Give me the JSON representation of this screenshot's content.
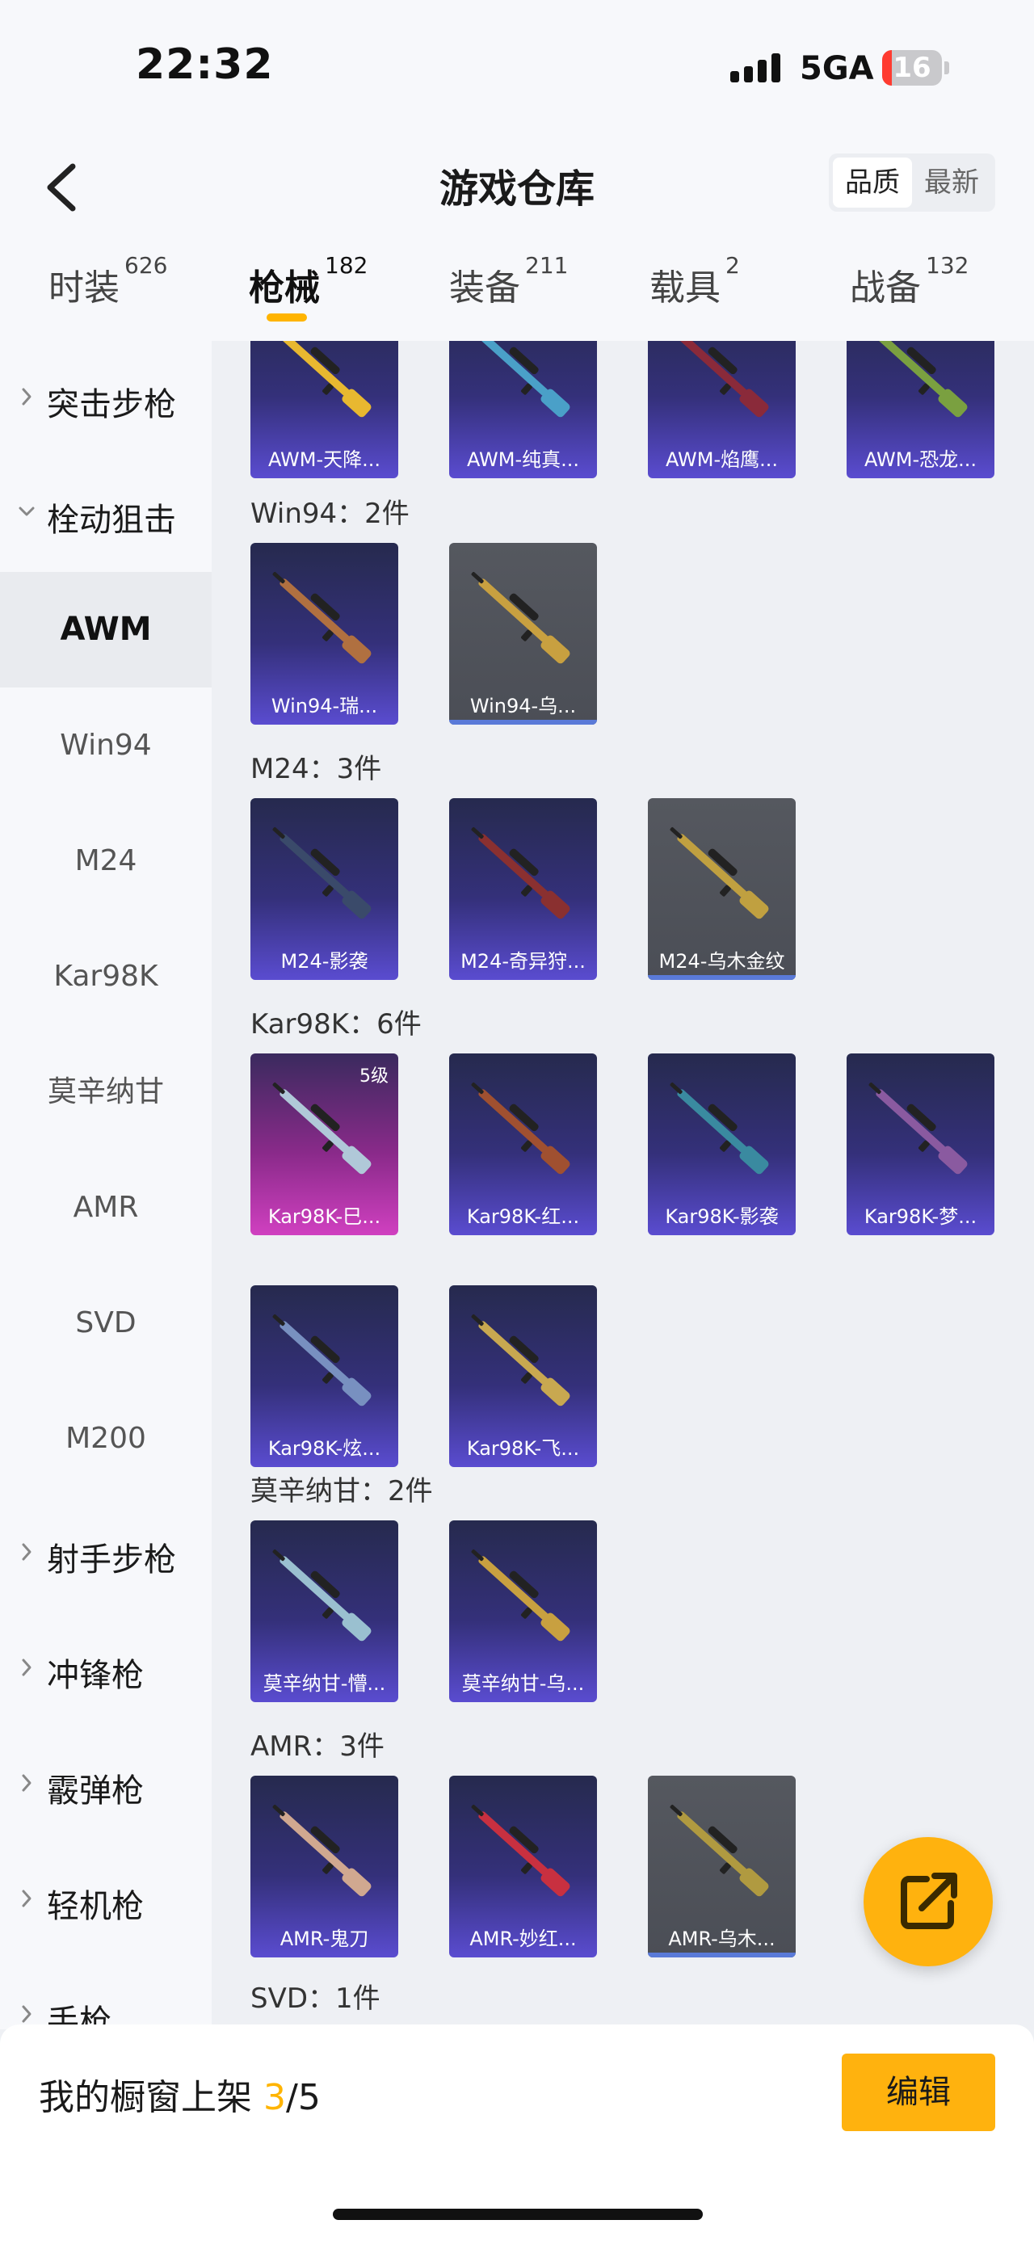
{
  "status_bar": {
    "time": "22:32",
    "network": "5GA",
    "battery": "16",
    "battery_level": 0.16
  },
  "header": {
    "title": "游戏仓库",
    "sort_options": [
      "品质",
      "最新"
    ],
    "sort_selected": "品质",
    "tabs": [
      {
        "label": "时装",
        "count": "626",
        "active": false
      },
      {
        "label": "枪械",
        "count": "182",
        "active": true
      },
      {
        "label": "装备",
        "count": "211",
        "active": false
      },
      {
        "label": "载具",
        "count": "2",
        "active": false
      },
      {
        "label": "战备",
        "count": "132",
        "active": false
      }
    ]
  },
  "sidebar": {
    "categories_top": [
      {
        "label": "突击步枪",
        "expanded": false
      },
      {
        "label": "栓动狙击",
        "expanded": true
      }
    ],
    "subs": [
      {
        "label": "AWM",
        "active": true
      },
      {
        "label": "Win94",
        "active": false
      },
      {
        "label": "M24",
        "active": false
      },
      {
        "label": "Kar98K",
        "active": false
      },
      {
        "label": "莫辛纳甘",
        "active": false
      },
      {
        "label": "AMR",
        "active": false
      },
      {
        "label": "SVD",
        "active": false
      },
      {
        "label": "M200",
        "active": false
      }
    ],
    "categories_bottom": [
      {
        "label": "射手步枪",
        "expanded": false
      },
      {
        "label": "冲锋枪",
        "expanded": false
      },
      {
        "label": "霰弹枪",
        "expanded": false
      },
      {
        "label": "轻机枪",
        "expanded": false
      },
      {
        "label": "手枪",
        "expanded": false
      }
    ]
  },
  "main": {
    "top_items": [
      {
        "name": "AWM-天降...",
        "rarity": "purple",
        "color": "#e8b830"
      },
      {
        "name": "AWM-纯真...",
        "rarity": "purple",
        "color": "#4aa0c8"
      },
      {
        "name": "AWM-焰鹰...",
        "rarity": "purple",
        "color": "#8a2a3a"
      },
      {
        "name": "AWM-恐龙...",
        "rarity": "purple",
        "color": "#7aa040"
      }
    ],
    "groups": [
      {
        "label": "Win94：2件",
        "items": [
          {
            "name": "Win94-瑞...",
            "rarity": "purple",
            "color": "#b07040"
          },
          {
            "name": "Win94-乌...",
            "rarity": "grey",
            "color": "#c8a040"
          }
        ]
      },
      {
        "label": "M24：3件",
        "items": [
          {
            "name": "M24-影袭",
            "rarity": "purple",
            "color": "#3a4a6a"
          },
          {
            "name": "M24-奇异狩...",
            "rarity": "purple",
            "color": "#8a3030"
          },
          {
            "name": "M24-乌木金纹",
            "rarity": "grey",
            "color": "#c0a040"
          }
        ]
      },
      {
        "label": "Kar98K：6件",
        "items": [
          {
            "name": "Kar98K-巳...",
            "rarity": "pink",
            "color": "#b0c8d8",
            "level": "5级"
          },
          {
            "name": "Kar98K-红...",
            "rarity": "purple",
            "color": "#a05030"
          },
          {
            "name": "Kar98K-影袭",
            "rarity": "purple",
            "color": "#3a8aa0"
          },
          {
            "name": "Kar98K-梦...",
            "rarity": "purple",
            "color": "#8a5aa0"
          },
          {
            "name": "Kar98K-炫...",
            "rarity": "purple",
            "color": "#7890c0"
          },
          {
            "name": "Kar98K-飞...",
            "rarity": "purple",
            "color": "#c8a850"
          }
        ]
      },
      {
        "label": "莫辛纳甘：2件",
        "items": [
          {
            "name": "莫辛纳甘-懵...",
            "rarity": "purple",
            "color": "#9ac0d0"
          },
          {
            "name": "莫辛纳甘-乌...",
            "rarity": "purple",
            "color": "#c8a040"
          }
        ]
      },
      {
        "label": "AMR：3件",
        "items": [
          {
            "name": "AMR-鬼刀",
            "rarity": "purple",
            "color": "#d0a890"
          },
          {
            "name": "AMR-妙红...",
            "rarity": "purple",
            "color": "#c83040"
          },
          {
            "name": "AMR-乌木...",
            "rarity": "grey",
            "color": "#b09a40"
          }
        ]
      },
      {
        "label": "SVD：1件",
        "items": []
      }
    ]
  },
  "bottom_bar": {
    "showcase_prefix": "我的橱窗上架 ",
    "showcase_count": "3",
    "showcase_total": "/5",
    "edit_label": "编辑"
  },
  "colors": {
    "accent": "#ffb20e",
    "rarity_purple": "#5a4cc8",
    "rarity_pink": "#c040b0",
    "rarity_grey": "#5a5d66"
  }
}
